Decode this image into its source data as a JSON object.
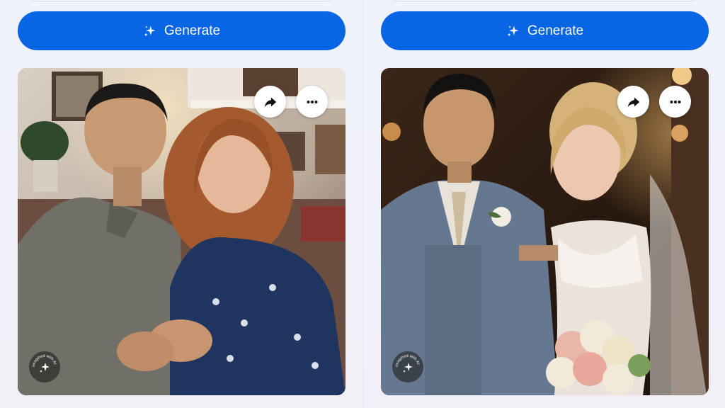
{
  "panels": [
    {
      "generate_label": "Generate",
      "watermark_text": "Imagined with AI"
    },
    {
      "generate_label": "Generate",
      "watermark_text": "Imagined with AI"
    }
  ],
  "icons": {
    "generate": "sparkles-icon",
    "share": "share-arrow-icon",
    "more": "more-horizontal-icon",
    "watermark": "ai-sparkle-icon"
  },
  "colors": {
    "accent": "#0866e5",
    "button_text": "#ffffff"
  }
}
